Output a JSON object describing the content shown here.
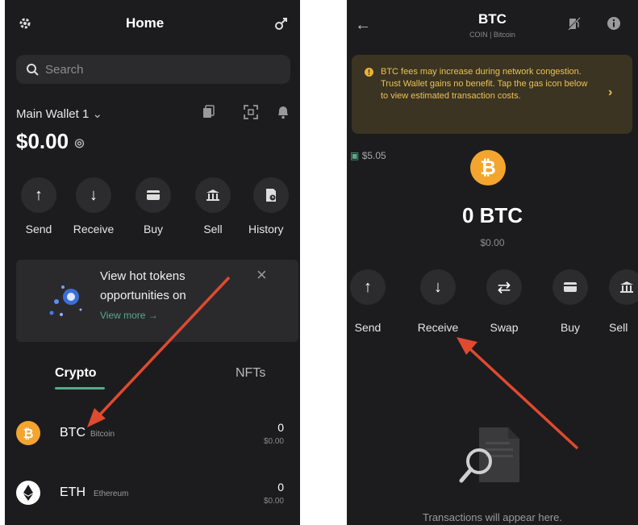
{
  "left": {
    "header": {
      "title": "Home"
    },
    "search": {
      "placeholder": "Search"
    },
    "wallet": {
      "name": "Main Wallet 1",
      "balance": "$0.00"
    },
    "actions": [
      {
        "label": "Send",
        "icon": "arrow-up-icon"
      },
      {
        "label": "Receive",
        "icon": "arrow-down-icon"
      },
      {
        "label": "Buy",
        "icon": "card-icon"
      },
      {
        "label": "Sell",
        "icon": "bank-icon"
      },
      {
        "label": "History",
        "icon": "history-icon"
      }
    ],
    "promo": {
      "line1": "View hot tokens",
      "line2": "opportunities on",
      "link": "View more →"
    },
    "tabs": {
      "crypto": "Crypto",
      "nfts": "NFTs"
    },
    "tokens": [
      {
        "symbol": "BTC",
        "name": "Bitcoin",
        "amount": "0",
        "usd": "$0.00",
        "color": "#f3a530"
      },
      {
        "symbol": "ETH",
        "name": "Ethereum",
        "amount": "0",
        "usd": "$0.00",
        "color": "#ffffff"
      }
    ]
  },
  "right": {
    "header": {
      "title": "BTC",
      "subtitle": "COIN | Bitcoin"
    },
    "warning": {
      "text": "BTC fees may increase during network congestion. Trust Wallet gains no benefit. Tap the gas icon below to view estimated transaction costs."
    },
    "fee": "$5.05",
    "balance": "0 BTC",
    "balance_usd": "$0.00",
    "actions": [
      {
        "label": "Send",
        "icon": "arrow-up-icon"
      },
      {
        "label": "Receive",
        "icon": "arrow-down-icon"
      },
      {
        "label": "Swap",
        "icon": "swap-icon"
      },
      {
        "label": "Buy",
        "icon": "card-icon"
      },
      {
        "label": "Sell",
        "icon": "bank-icon"
      }
    ],
    "empty_state": "Transactions will appear here."
  },
  "colors": {
    "background": "#1c1c1e",
    "surface": "#2c2c2f",
    "accent": "#5aa88a",
    "btc": "#f3a530",
    "warning_text": "#e9c15a",
    "arrow": "#e04a2f"
  }
}
